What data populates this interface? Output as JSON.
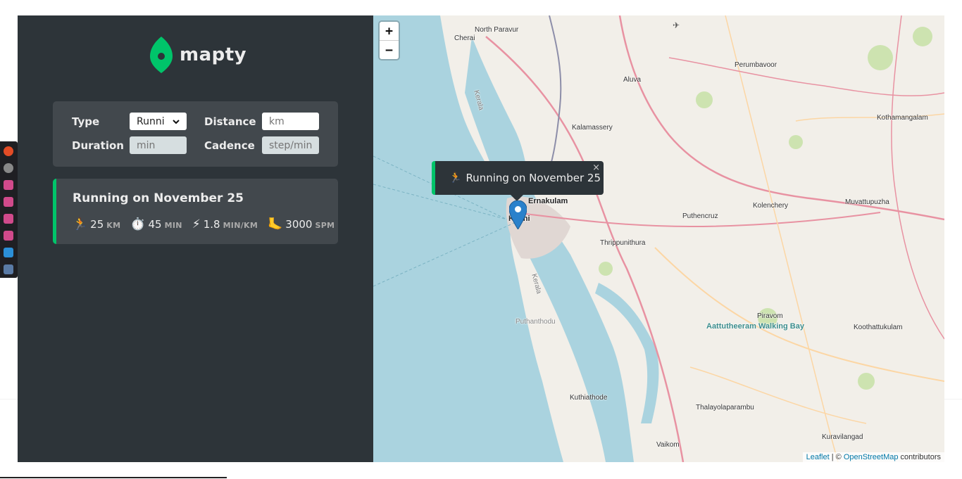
{
  "logo": {
    "text": "mapty"
  },
  "form": {
    "type_label": "Type",
    "type_value": "Runni",
    "distance_label": "Distance",
    "distance_placeholder": "km",
    "duration_label": "Duration",
    "duration_placeholder": "min",
    "cadence_label": "Cadence",
    "cadence_placeholder": "step/min"
  },
  "workouts": [
    {
      "title": "Running on November 25",
      "distance": "25",
      "distance_unit": "KM",
      "distance_icon": "🏃",
      "duration": "45",
      "duration_unit": "MIN",
      "duration_icon": "⏱️",
      "pace": "1.8",
      "pace_unit": "MIN/KM",
      "pace_icon": "⚡",
      "cadence": "3000",
      "cadence_unit": "SPM",
      "cadence_icon": "🦶"
    }
  ],
  "map": {
    "zoom_in": "+",
    "zoom_out": "−",
    "popup_text": "Running on November 25",
    "popup_icon": "🏃",
    "popup_close": "×",
    "places": [
      "North Paravur",
      "Cherai",
      "Aluva",
      "Perumbavoor",
      "Kothamangalam",
      "Kalamassery",
      "Ernakulam",
      "Kochi",
      "Puthencruz",
      "Kolenchery",
      "Muvattupuzha",
      "Thrippunithura",
      "Piravom",
      "Aattutheeram Walking Bay",
      "Koothattukulam",
      "Puthanthodu",
      "Kuthiathode",
      "Thalayolaparambu",
      "Kuravilangad",
      "Vaikom",
      "Kerala",
      "Kerala"
    ],
    "attribution": {
      "leaflet": "Leaflet",
      "sep": " | © ",
      "osm": "OpenStreetMap",
      "contributors": " contributors"
    }
  },
  "colors": {
    "sidebar": "#2d3439",
    "card": "#42484d",
    "accent_green": "#00c46a",
    "water": "#aad3df"
  }
}
